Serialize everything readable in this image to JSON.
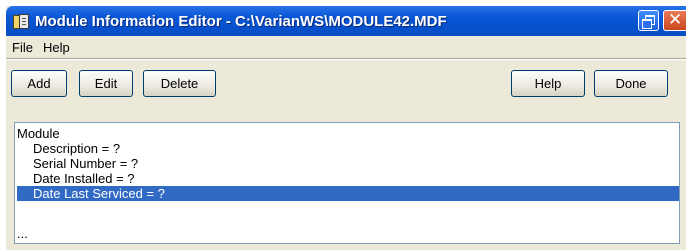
{
  "window": {
    "title": "Module Information Editor - C:\\VarianWS\\MODULE42.MDF"
  },
  "menu": [
    "File",
    "Help"
  ],
  "toolbar": {
    "add_label": "Add",
    "edit_label": "Edit",
    "delete_label": "Delete",
    "help_label": "Help",
    "done_label": "Done"
  },
  "list": {
    "root": "Module",
    "items": [
      "Description = ?",
      "Serial Number = ?",
      "Date Installed = ?",
      "Date Last Serviced = ?"
    ],
    "selected_index": 3,
    "trailing": "..."
  },
  "colors": {
    "titlebar": "#0a58d6",
    "selection": "#316ac5",
    "window_bg": "#ece9d8"
  }
}
